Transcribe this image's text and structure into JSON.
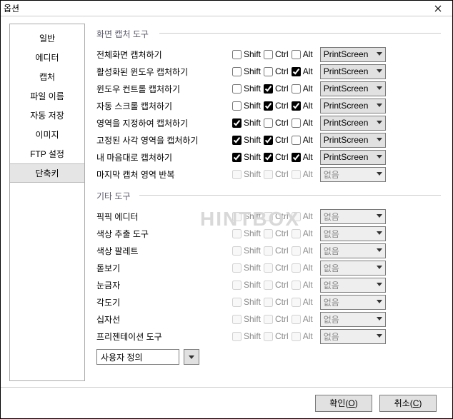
{
  "window": {
    "title": "옵션"
  },
  "sidebar": {
    "items": [
      {
        "label": "일반"
      },
      {
        "label": "에디터"
      },
      {
        "label": "캡처"
      },
      {
        "label": "파일 이름"
      },
      {
        "label": "자동 저장"
      },
      {
        "label": "이미지"
      },
      {
        "label": "FTP 설정"
      },
      {
        "label": "단축키",
        "selected": true
      }
    ]
  },
  "groups": {
    "capture": {
      "label": "화면 캡처 도구"
    },
    "other": {
      "label": "기타 도구"
    }
  },
  "mods": {
    "shift": "Shift",
    "ctrl": "Ctrl",
    "alt": "Alt"
  },
  "capture_rows": [
    {
      "label": "전체화면 캡처하기",
      "shift": false,
      "ctrl": false,
      "alt": false,
      "key": "PrintScreen",
      "disabled": false
    },
    {
      "label": "활성화된 윈도우 캡처하기",
      "shift": false,
      "ctrl": false,
      "alt": true,
      "key": "PrintScreen",
      "disabled": false
    },
    {
      "label": "윈도우 컨트롤 캡처하기",
      "shift": false,
      "ctrl": true,
      "alt": false,
      "key": "PrintScreen",
      "disabled": false
    },
    {
      "label": "자동 스크롤 캡처하기",
      "shift": false,
      "ctrl": true,
      "alt": true,
      "key": "PrintScreen",
      "disabled": false
    },
    {
      "label": "영역을 지정하여 캡처하기",
      "shift": true,
      "ctrl": false,
      "alt": false,
      "key": "PrintScreen",
      "disabled": false
    },
    {
      "label": "고정된 사각 영역을 캡처하기",
      "shift": true,
      "ctrl": true,
      "alt": false,
      "key": "PrintScreen",
      "disabled": false
    },
    {
      "label": "내 마음대로 캡처하기",
      "shift": true,
      "ctrl": true,
      "alt": true,
      "key": "PrintScreen",
      "disabled": false
    },
    {
      "label": "마지막 캡처 영역 반복",
      "shift": false,
      "ctrl": false,
      "alt": false,
      "key": "없음",
      "disabled": true
    }
  ],
  "other_rows": [
    {
      "label": "픽픽 에디터",
      "shift": false,
      "ctrl": false,
      "alt": false,
      "key": "없음",
      "disabled": true
    },
    {
      "label": "색상 추출 도구",
      "shift": false,
      "ctrl": false,
      "alt": false,
      "key": "없음",
      "disabled": true
    },
    {
      "label": "색상 팔레트",
      "shift": false,
      "ctrl": false,
      "alt": false,
      "key": "없음",
      "disabled": true
    },
    {
      "label": "돋보기",
      "shift": false,
      "ctrl": false,
      "alt": false,
      "key": "없음",
      "disabled": true
    },
    {
      "label": "눈금자",
      "shift": false,
      "ctrl": false,
      "alt": false,
      "key": "없음",
      "disabled": true
    },
    {
      "label": "각도기",
      "shift": false,
      "ctrl": false,
      "alt": false,
      "key": "없음",
      "disabled": true
    },
    {
      "label": "십자선",
      "shift": false,
      "ctrl": false,
      "alt": false,
      "key": "없음",
      "disabled": true
    },
    {
      "label": "프리젠테이션 도구",
      "shift": false,
      "ctrl": false,
      "alt": false,
      "key": "없음",
      "disabled": true
    }
  ],
  "custom": {
    "value": "사용자 정의"
  },
  "footer": {
    "ok": {
      "label": "확인",
      "accel": "O"
    },
    "cancel": {
      "label": "취소",
      "accel": "C"
    }
  },
  "watermark": "HINTBOX"
}
